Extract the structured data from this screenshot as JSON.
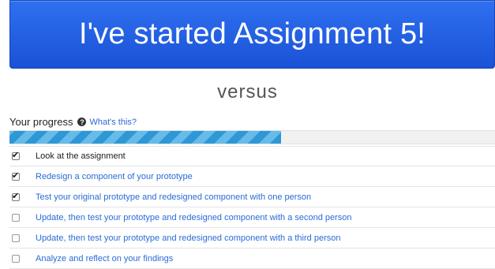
{
  "banner_button": {
    "label": "I've started Assignment 5!"
  },
  "divider_text": "versus",
  "progress": {
    "label": "Your progress",
    "help_icon": "question-circle-icon",
    "help_link": "What's this?",
    "fraction": 0.56,
    "colors": {
      "stripe_dark": "#2e97d6",
      "stripe_light": "#67bbe9",
      "link": "#2a6bd6",
      "button": "#1f5fe6"
    }
  },
  "tasks": [
    {
      "label": "Look at the assignment",
      "checked": true,
      "link": false
    },
    {
      "label": "Redesign a component of your prototype",
      "checked": true,
      "link": true
    },
    {
      "label": "Test your original prototype and redesigned component with one person",
      "checked": true,
      "link": true
    },
    {
      "label": "Update, then test your prototype and redesigned component with a second person",
      "checked": false,
      "link": true
    },
    {
      "label": "Update, then test your prototype and redesigned component with a third person",
      "checked": false,
      "link": true
    },
    {
      "label": "Analyze and reflect on your findings",
      "checked": false,
      "link": true
    }
  ]
}
